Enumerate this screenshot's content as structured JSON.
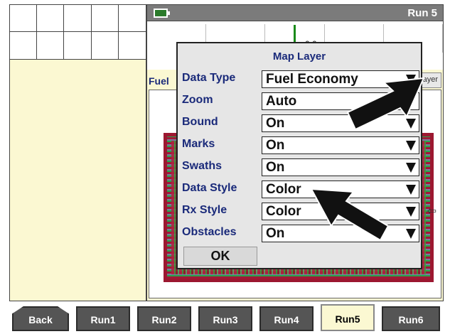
{
  "header": {
    "run_label": "Run 5",
    "battery_icon": "battery-icon"
  },
  "top_strip": {
    "partial_text": "0.0 ..."
  },
  "map": {
    "data_label": "Fuel",
    "layer_button_label": "ayer"
  },
  "modal": {
    "title": "Map Layer",
    "rows": [
      {
        "label": "Data Type",
        "value": "Fuel Economy"
      },
      {
        "label": "Zoom",
        "value": "Auto"
      },
      {
        "label": "Bound",
        "value": "On"
      },
      {
        "label": "Marks",
        "value": "On"
      },
      {
        "label": "Swaths",
        "value": "On"
      },
      {
        "label": "Data Style",
        "value": "Color"
      },
      {
        "label": "Rx Style",
        "value": "Color"
      },
      {
        "label": "Obstacles",
        "value": "On"
      }
    ],
    "ok_label": "OK"
  },
  "tabs": [
    "Back",
    "Run1",
    "Run2",
    "Run3",
    "Run4",
    "Run5",
    "Run6"
  ],
  "colors": {
    "title_bar": "#7b7b7b",
    "panel_bg": "#fbf8d2",
    "label_blue": "#1a2a7a",
    "tab_dark": "#555555"
  }
}
